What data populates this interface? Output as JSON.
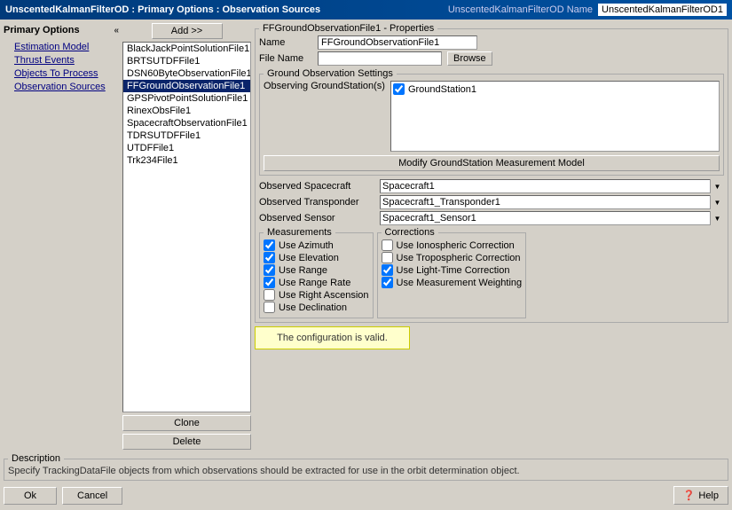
{
  "titleBar": {
    "title": "UnscentedKalmanFilterOD : Primary Options : Observation Sources",
    "nameLabel": "UnscentedKalmanFilterOD Name",
    "nameValue": "UnscentedKalmanFilterOD1"
  },
  "leftNav": {
    "header": "Primary Options",
    "items": [
      "Estimation Model",
      "Thrust Events",
      "Objects To Process",
      "Observation Sources"
    ]
  },
  "fileList": {
    "addButton": "Add >>",
    "items": [
      "BlackJackPointSolutionFile1",
      "BRTSUTDFFile1",
      "DSN60ByteObservationFile1",
      "FFGroundObservationFile1",
      "GPSPivotPointSolutionFile1",
      "RinexObsFile1",
      "SpacecraftObservationFile1",
      "TDRSUTDFFile1",
      "UTDFFile1",
      "Trk234File1"
    ],
    "selectedIndex": 3,
    "cloneButton": "Clone",
    "deleteButton": "Delete"
  },
  "properties": {
    "groupTitle": "FFGroundObservationFile1 - Properties",
    "nameLabel": "Name",
    "nameValue": "FFGroundObservationFile1",
    "fileNameLabel": "File Name",
    "fileNameValue": "",
    "browseButton": "Browse",
    "groundObsSettings": {
      "legend": "Ground Observation Settings",
      "observingLabel": "Observing GroundStation(s)",
      "stations": [
        {
          "checked": true,
          "name": "GroundStation1"
        }
      ],
      "modifyButton": "Modify GroundStation Measurement Model"
    },
    "observedSpacecraftLabel": "Observed Spacecraft",
    "observedSpacecraftValue": "Spacecraft1",
    "observedTransponderLabel": "Observed Transponder",
    "observedTransponderValue": "Spacecraft1_Transponder1",
    "observedSensorLabel": "Observed Sensor",
    "observedSensorValue": "Spacecraft1_Sensor1"
  },
  "measurements": {
    "legend": "Measurements",
    "items": [
      {
        "checked": true,
        "label": "Use Azimuth"
      },
      {
        "checked": true,
        "label": "Use Elevation"
      },
      {
        "checked": true,
        "label": "Use Range"
      },
      {
        "checked": true,
        "label": "Use Range Rate"
      },
      {
        "checked": false,
        "label": "Use Right Ascension"
      },
      {
        "checked": false,
        "label": "Use Declination"
      }
    ]
  },
  "corrections": {
    "legend": "Corrections",
    "items": [
      {
        "checked": false,
        "label": "Use Ionospheric Correction"
      },
      {
        "checked": false,
        "label": "Use Tropospheric Correction"
      },
      {
        "checked": true,
        "label": "Use Light-Time Correction"
      },
      {
        "checked": true,
        "label": "Use Measurement Weighting"
      }
    ]
  },
  "validPanel": {
    "message": "The configuration is valid."
  },
  "description": {
    "legend": "Description",
    "text": "Specify TrackingDataFile objects from which observations should be extracted for use in the orbit determination object."
  },
  "buttons": {
    "ok": "Ok",
    "cancel": "Cancel",
    "help": "Help"
  }
}
